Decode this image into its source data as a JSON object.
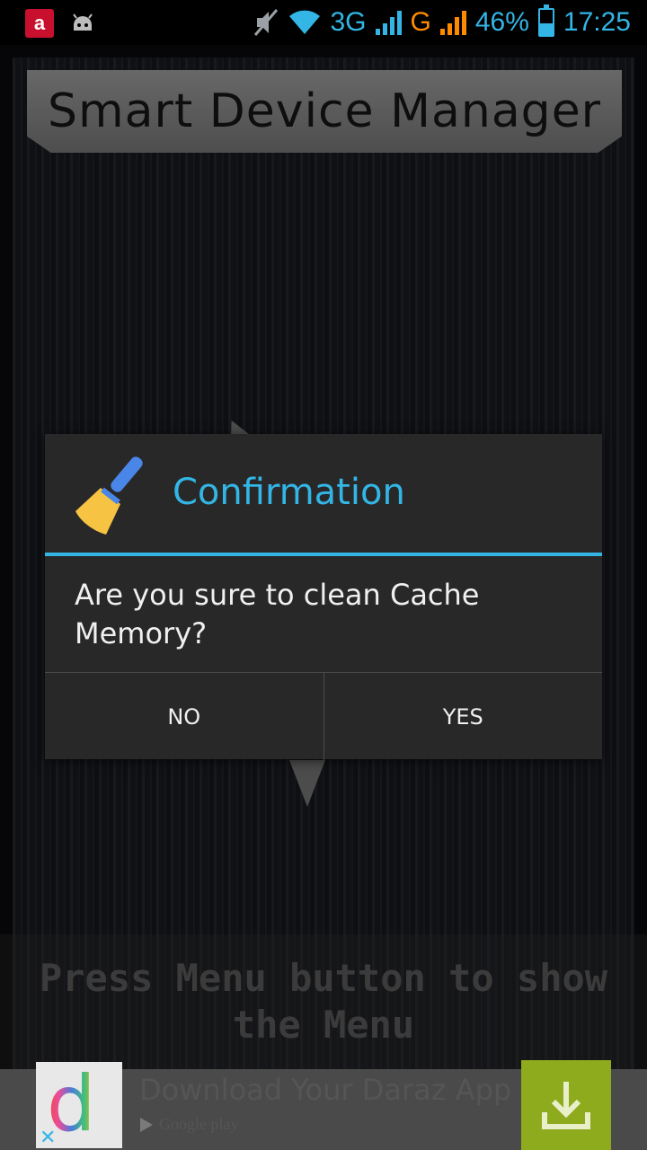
{
  "status_bar": {
    "network1": "3G",
    "sim1_index": "1",
    "network2": "G",
    "sim2_index": "2",
    "battery": "46%",
    "battery_level": 0.46,
    "time": "17:25",
    "icons": [
      "avira-icon",
      "android-debug-icon",
      "mute-icon",
      "wifi-icon",
      "signal-icon",
      "battery-charging-icon"
    ],
    "accent_color": "#33b5e5",
    "sim2_color": "#ff8a00"
  },
  "app": {
    "title": "Smart Device Manager",
    "menu_hint": "Press Menu button to show the Menu"
  },
  "dialog": {
    "title": "Confirmation",
    "icon": "broom-icon",
    "message": "Are you sure to clean Cache Memory?",
    "no_label": "NO",
    "yes_label": "YES",
    "accent_color": "#33b5e5"
  },
  "ad": {
    "title": "Download Your Daraz App",
    "store": "Google play",
    "logo_letter": "d",
    "close_glyph": "✕",
    "button_color": "#8eaa1d"
  }
}
